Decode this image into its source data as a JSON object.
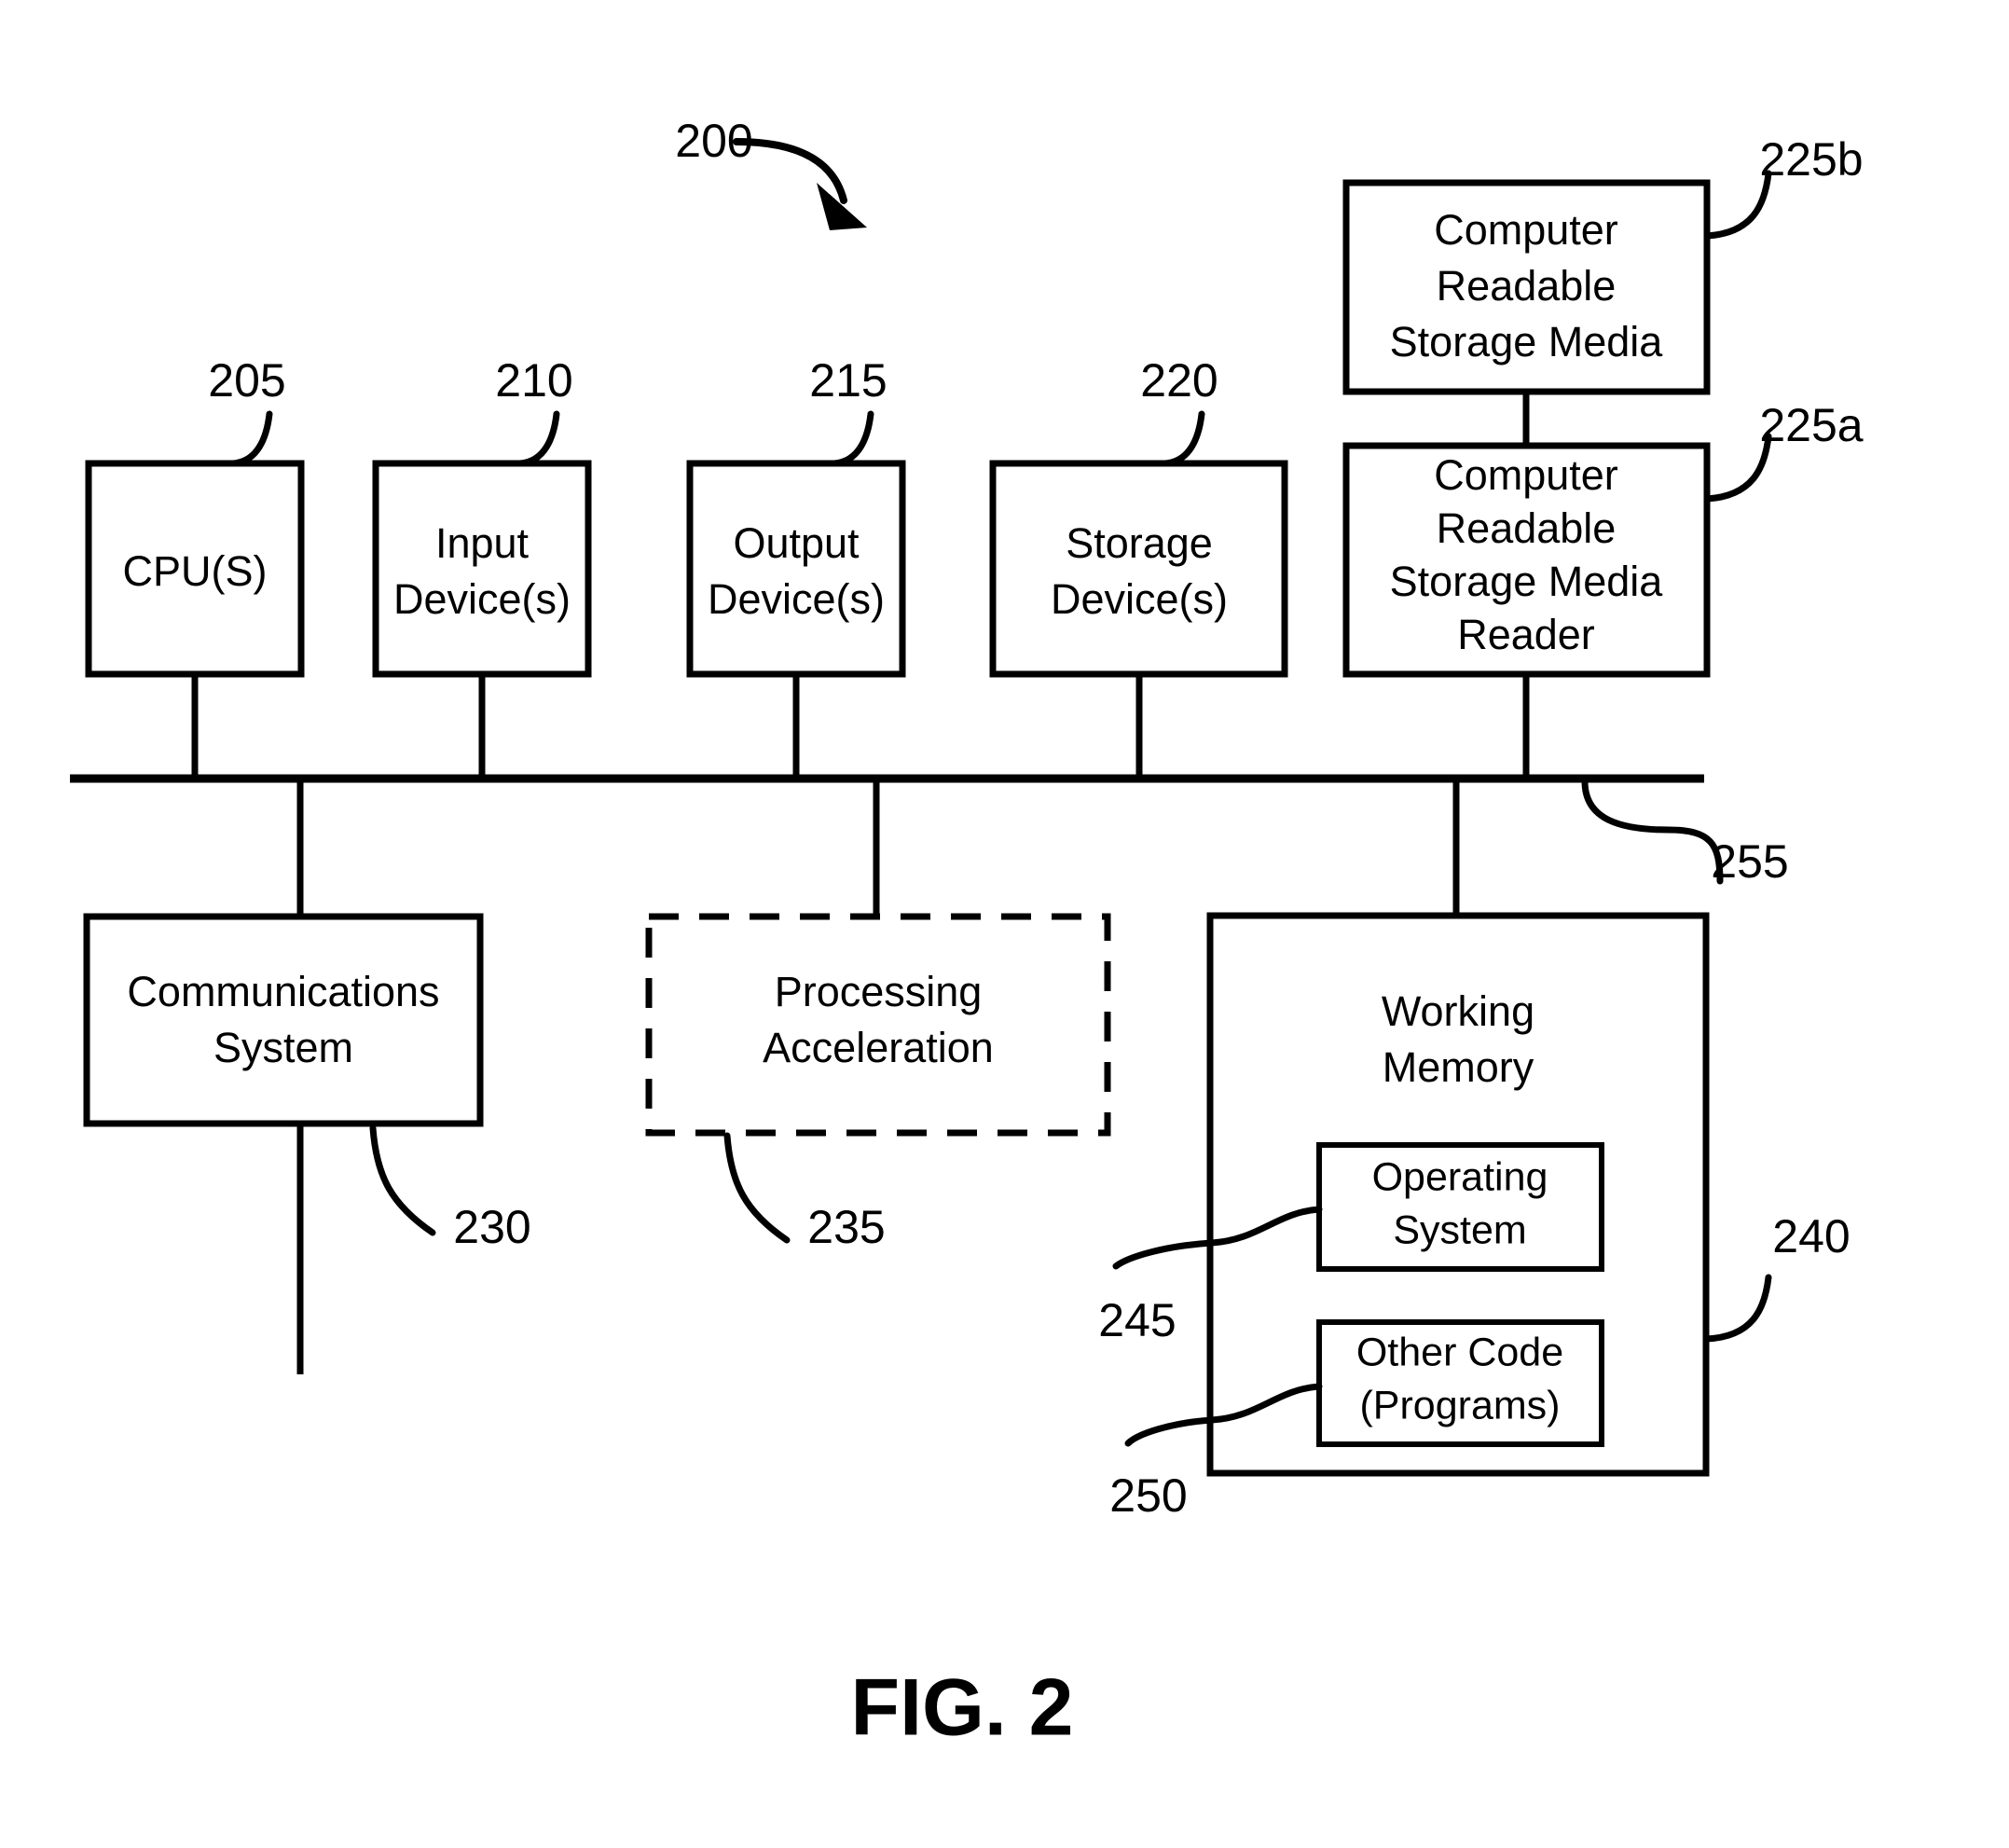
{
  "figure": {
    "caption": "FIG. 2",
    "system_ref": "200"
  },
  "top_row_boxes": [
    {
      "ref": "205",
      "lines": [
        "CPU(S)"
      ]
    },
    {
      "ref": "210",
      "lines": [
        "Input",
        "Device(s)"
      ]
    },
    {
      "ref": "215",
      "lines": [
        "Output",
        "Device(s)"
      ]
    },
    {
      "ref": "220",
      "lines": [
        "Storage",
        "Device(s)"
      ]
    }
  ],
  "storage_media_boxes": [
    {
      "ref": "225b",
      "lines": [
        "Computer",
        "Readable",
        "Storage Media"
      ]
    },
    {
      "ref": "225a",
      "lines": [
        "Computer",
        "Readable",
        "Storage Media",
        "Reader"
      ]
    }
  ],
  "bus": {
    "ref": "255"
  },
  "bottom_row_boxes": [
    {
      "ref": "230",
      "lines": [
        "Communications",
        "System"
      ],
      "style": "solid"
    },
    {
      "ref": "235",
      "lines": [
        "Processing",
        "Acceleration"
      ],
      "style": "dashed"
    },
    {
      "ref": "240",
      "lines": [
        "Working",
        "Memory"
      ],
      "style": "solid"
    }
  ],
  "working_memory_inner_boxes": [
    {
      "ref": "245",
      "lines": [
        "Operating",
        "System"
      ]
    },
    {
      "ref": "250",
      "lines": [
        "Other Code",
        "(Programs)"
      ]
    }
  ]
}
